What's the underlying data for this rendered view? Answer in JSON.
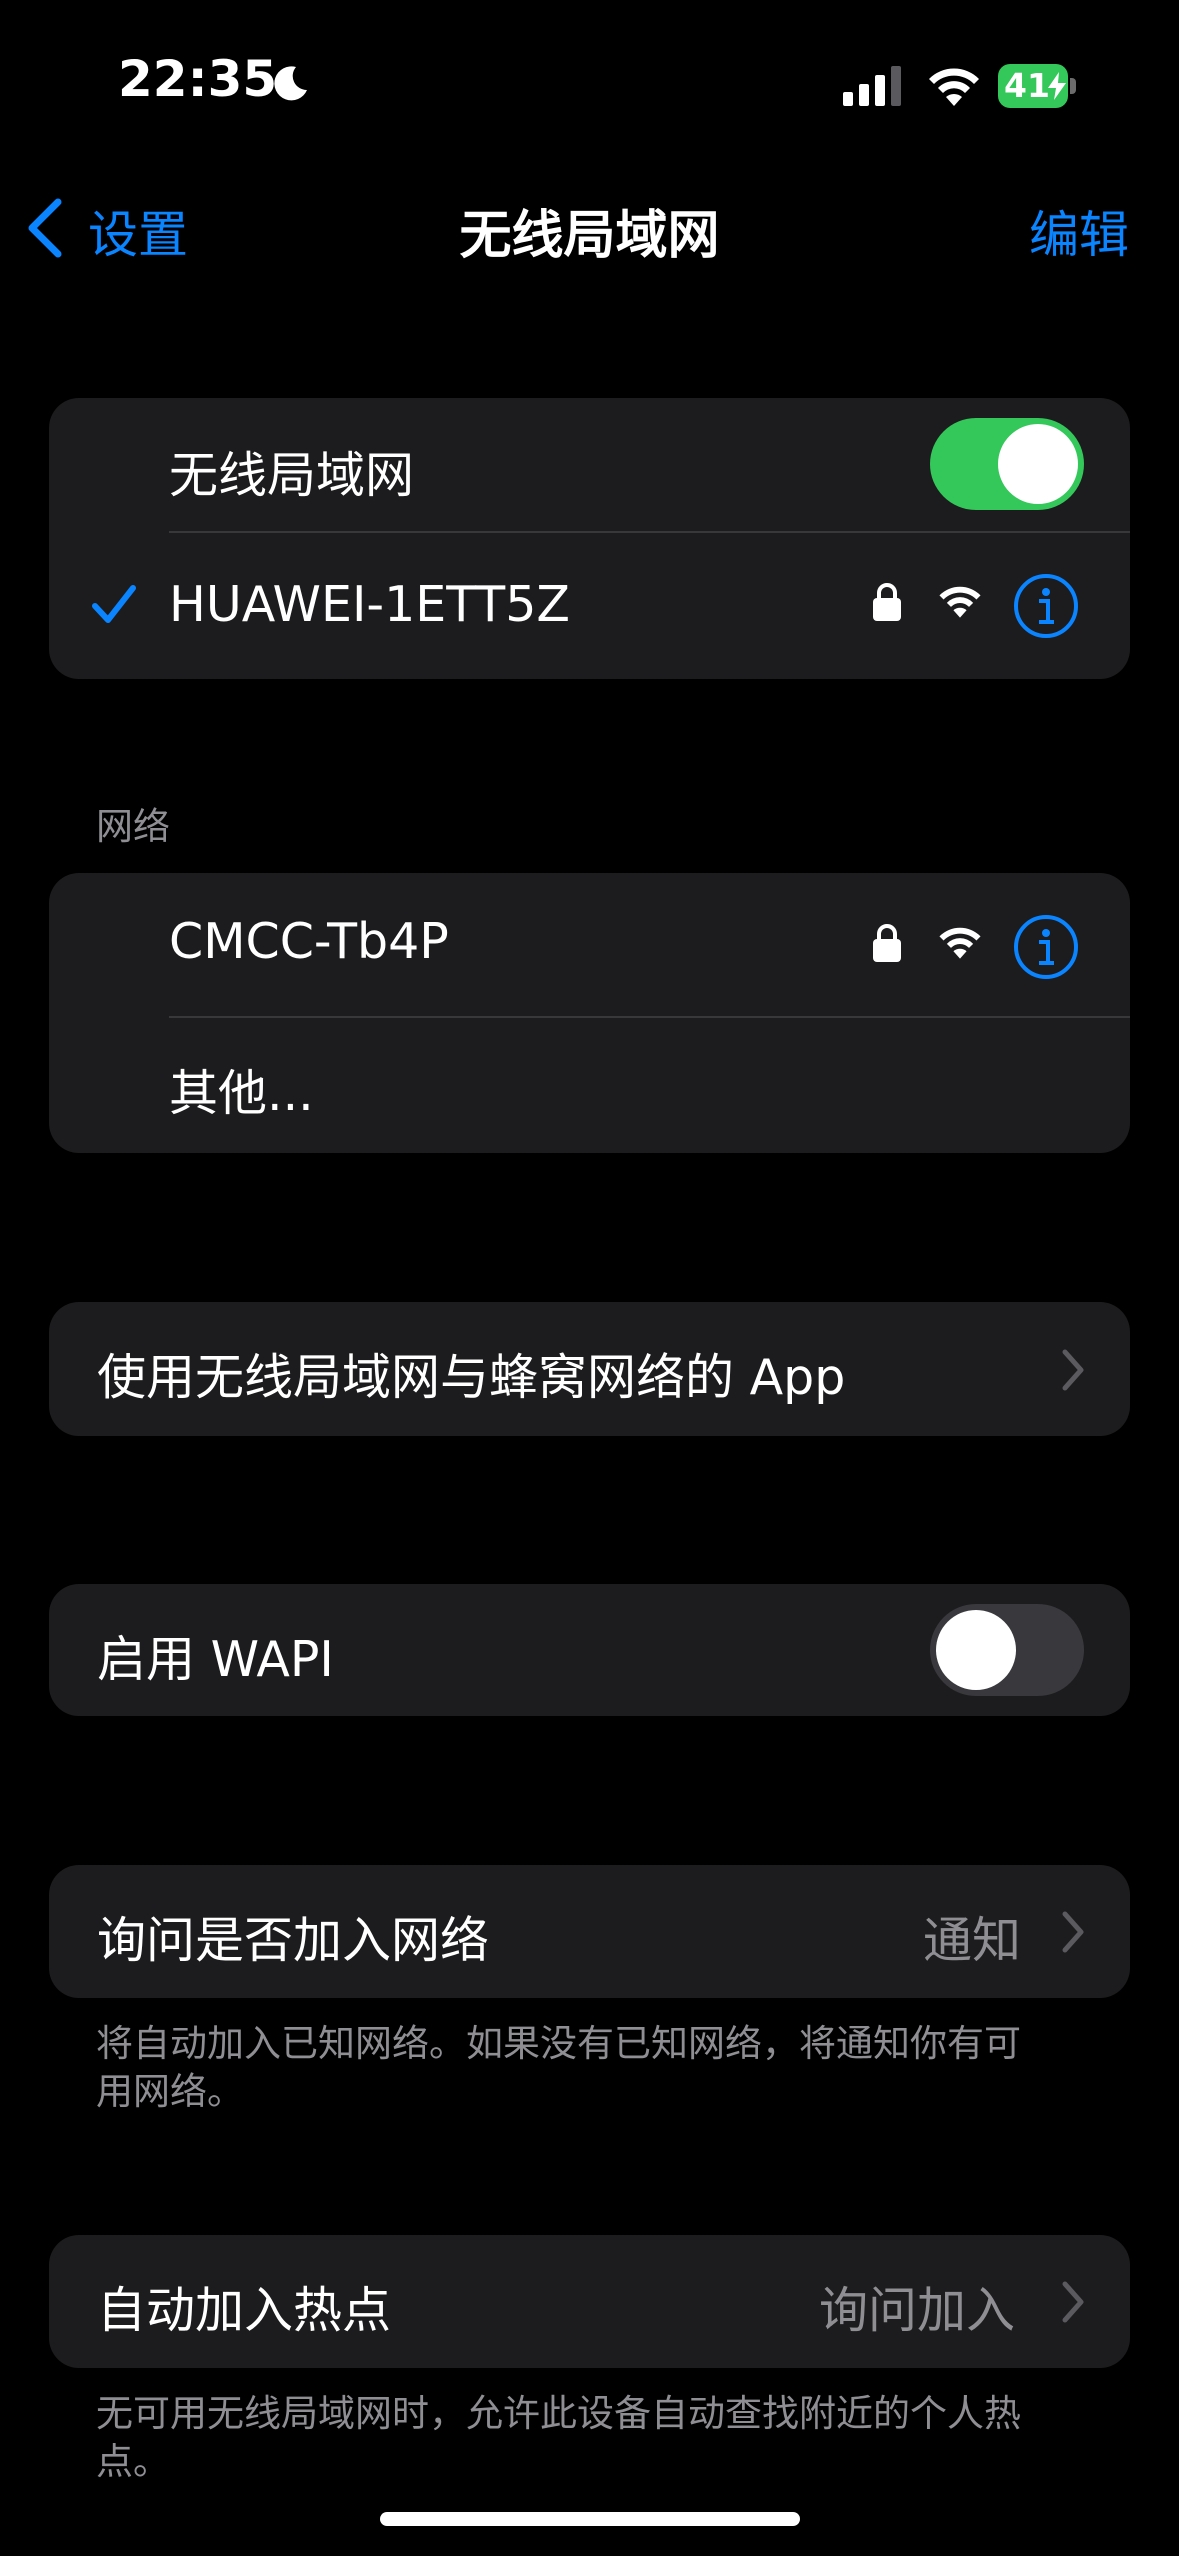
{
  "status_bar": {
    "time": "22:35",
    "battery": "41"
  },
  "nav": {
    "back_label": "设置",
    "title": "无线局域网",
    "edit_label": "编辑"
  },
  "wifi_group": {
    "toggle_label": "无线局域网",
    "toggle_on": true,
    "connected_network": "HUAWEI-1ETT5Z"
  },
  "networks": {
    "header": "网络",
    "items": [
      {
        "name": "CMCC-Tb4P"
      },
      {
        "name": "其他..."
      }
    ]
  },
  "apps_row": {
    "label": "使用无线局域网与蜂窝网络的 App"
  },
  "wapi": {
    "label": "启用 WAPI",
    "toggle_on": false
  },
  "ask_join": {
    "label": "询问是否加入网络",
    "value": "通知",
    "footer": "将自动加入已知网络。如果没有已知网络，将通知你有可用网络。"
  },
  "hotspot": {
    "label": "自动加入热点",
    "value": "询问加入",
    "footer": "无可用无线局域网时，允许此设备自动查找附近的个人热点。"
  },
  "colors": {
    "accent": "#0a84ff",
    "toggle_on": "#34c759",
    "toggle_off": "#39393d",
    "cell": "#1c1c1e"
  }
}
